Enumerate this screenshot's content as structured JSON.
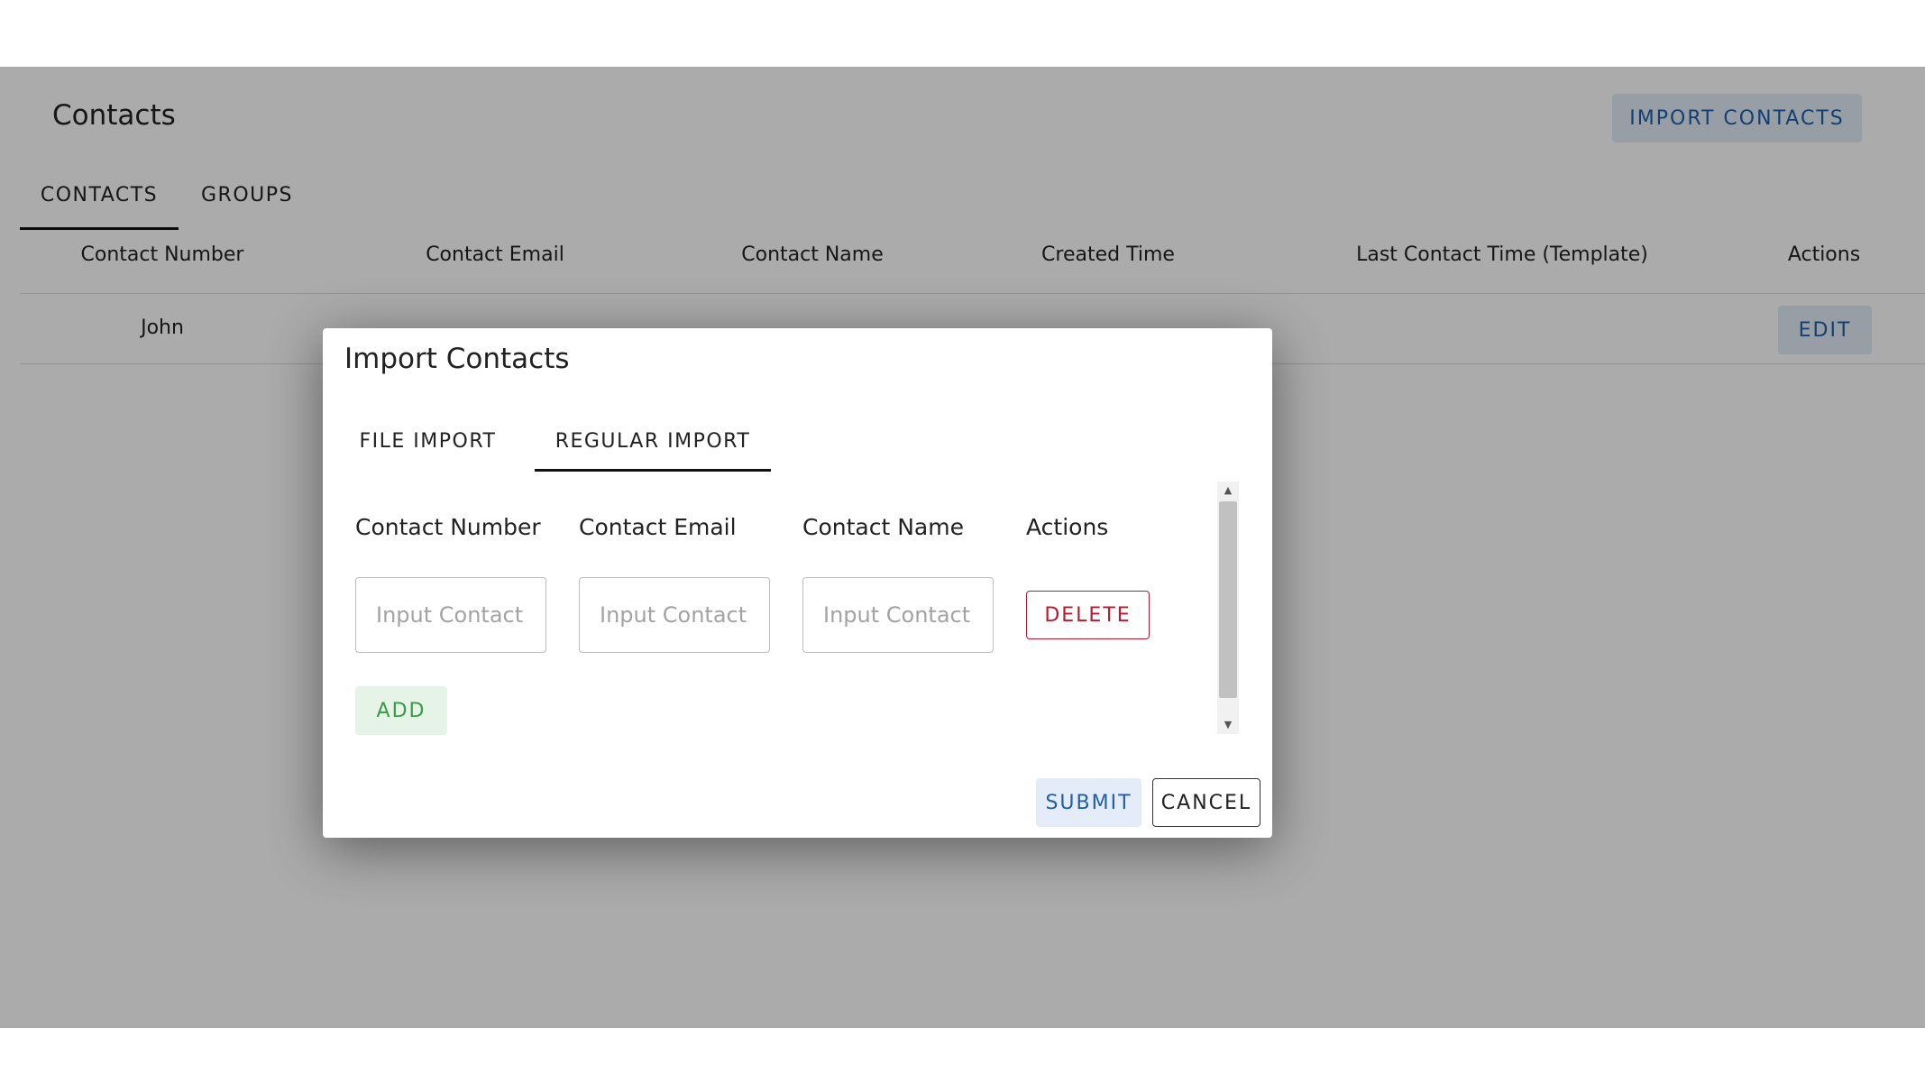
{
  "page": {
    "title": "Contacts",
    "import_button": "IMPORT CONTACTS",
    "tabs": [
      {
        "label": "CONTACTS",
        "active": true
      },
      {
        "label": "GROUPS",
        "active": false
      }
    ]
  },
  "table": {
    "columns": [
      "Contact Number",
      "Contact Email",
      "Contact Name",
      "Created Time",
      "Last Contact Time (Template)",
      "Actions"
    ],
    "rows": [
      {
        "contact_number": "John",
        "action": "EDIT"
      }
    ]
  },
  "dialog": {
    "title": "Import Contacts",
    "tabs": [
      {
        "label": "FILE IMPORT",
        "active": false
      },
      {
        "label": "REGULAR IMPORT",
        "active": true
      }
    ],
    "columns": [
      "Contact Number",
      "Contact Email",
      "Contact Name",
      "Actions"
    ],
    "row": {
      "number_placeholder": "Input Contact",
      "email_placeholder": "Input Contact",
      "name_placeholder": "Input Contact",
      "delete_label": "DELETE"
    },
    "add_label": "ADD",
    "submit_label": "SUBMIT",
    "cancel_label": "CANCEL"
  },
  "colors": {
    "primary": "#1f5fa8",
    "danger": "#c0172e",
    "success": "#3a9a48",
    "backdrop": "rgba(0,0,0,0.33)"
  },
  "icons": {
    "scroll_up": "arrow-up-icon",
    "scroll_down": "arrow-down-icon"
  }
}
